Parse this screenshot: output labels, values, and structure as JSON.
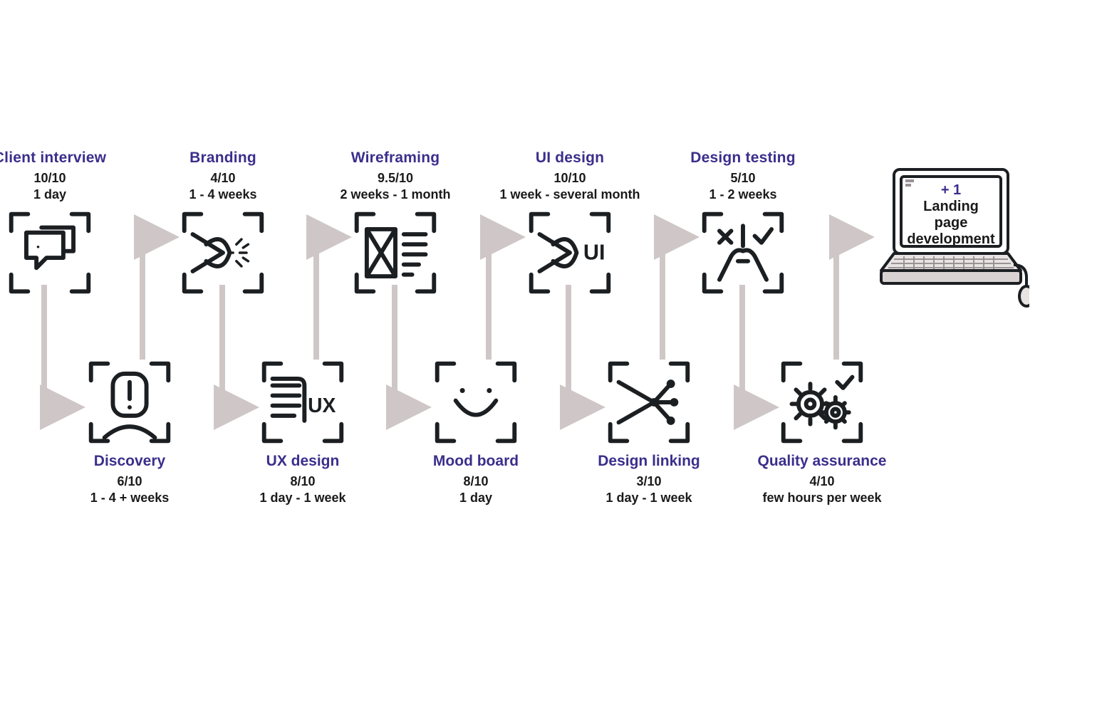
{
  "colors": {
    "accent": "#3b2e8c",
    "ink": "#1c1f22",
    "arrow": "#cfc7c7",
    "bg": "#ffffff"
  },
  "top_steps": [
    {
      "title": "Client interview",
      "score": "10/10",
      "duration": "1 day",
      "icon": "chat-bubbles-icon"
    },
    {
      "title": "Branding",
      "score": "4/10",
      "duration": "1 - 4 weeks",
      "icon": "eye-sparkle-icon"
    },
    {
      "title": "Wireframing",
      "score": "9.5/10",
      "duration": "2 weeks - 1 month",
      "icon": "hourglass-lines-icon"
    },
    {
      "title": "UI design",
      "score": "10/10",
      "duration": "1 week - several month",
      "icon": "eye-ui-icon"
    },
    {
      "title": "Design testing",
      "score": "5/10",
      "duration": "1 - 2 weeks",
      "icon": "check-x-pencil-icon"
    }
  ],
  "bottom_steps": [
    {
      "title": "Discovery",
      "score": "6/10",
      "duration": "1 - 4 + weeks",
      "icon": "person-alert-icon"
    },
    {
      "title": "UX design",
      "score": "8/10",
      "duration": "1 day - 1 week",
      "icon": "hand-ux-icon"
    },
    {
      "title": "Mood board",
      "score": "8/10",
      "duration": "1 day",
      "icon": "smile-icon"
    },
    {
      "title": "Design linking",
      "score": "3/10",
      "duration": "1 day - 1 week",
      "icon": "nodes-funnel-icon"
    },
    {
      "title": "Quality assurance",
      "score": "4/10",
      "duration": "few hours per week",
      "icon": "gears-check-icon"
    }
  ],
  "final": {
    "plus": "+ 1",
    "label_lines": [
      "Landing",
      "page",
      "development"
    ],
    "icon": "computer-icon"
  }
}
